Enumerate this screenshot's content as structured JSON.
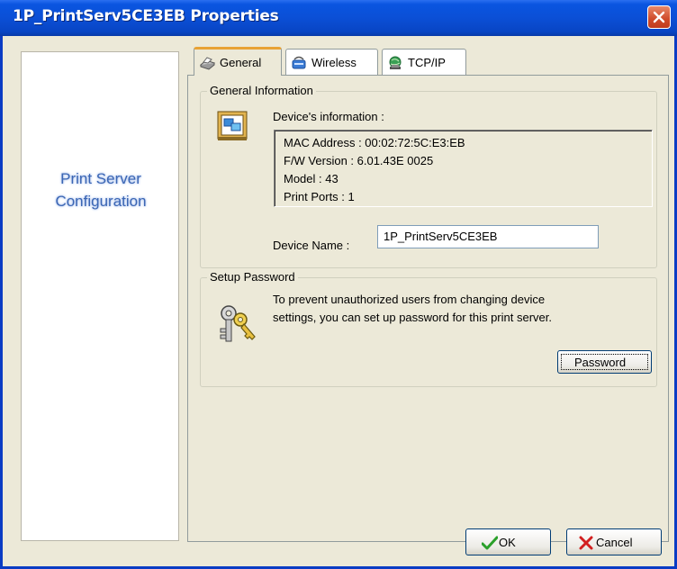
{
  "window": {
    "title": "1P_PrintServ5CE3EB Properties"
  },
  "sidebar": {
    "line1": "Print Server",
    "line2": "Configuration"
  },
  "tabs": [
    {
      "label": "General",
      "icon": "printer-icon",
      "active": true
    },
    {
      "label": "Wireless",
      "icon": "wireless-icon",
      "active": false
    },
    {
      "label": "TCP/IP",
      "icon": "network-globe-icon",
      "active": false
    }
  ],
  "general_info": {
    "group_title": "General Information",
    "device_info_label": "Device's information :",
    "lines": [
      "MAC Address : 00:02:72:5C:E3:EB",
      "F/W Version : 6.01.43E 0025",
      "Model : 43",
      "Print Ports : 1"
    ],
    "device_name_label": "Device Name :",
    "device_name_value": "1P_PrintServ5CE3EB"
  },
  "setup_password": {
    "group_title": "Setup Password",
    "description_line1": "To prevent unauthorized users from changing device",
    "description_line2": "settings, you can set up password for this print server.",
    "button_label": "Password"
  },
  "footer": {
    "ok_label": "OK",
    "cancel_label": "Cancel"
  }
}
